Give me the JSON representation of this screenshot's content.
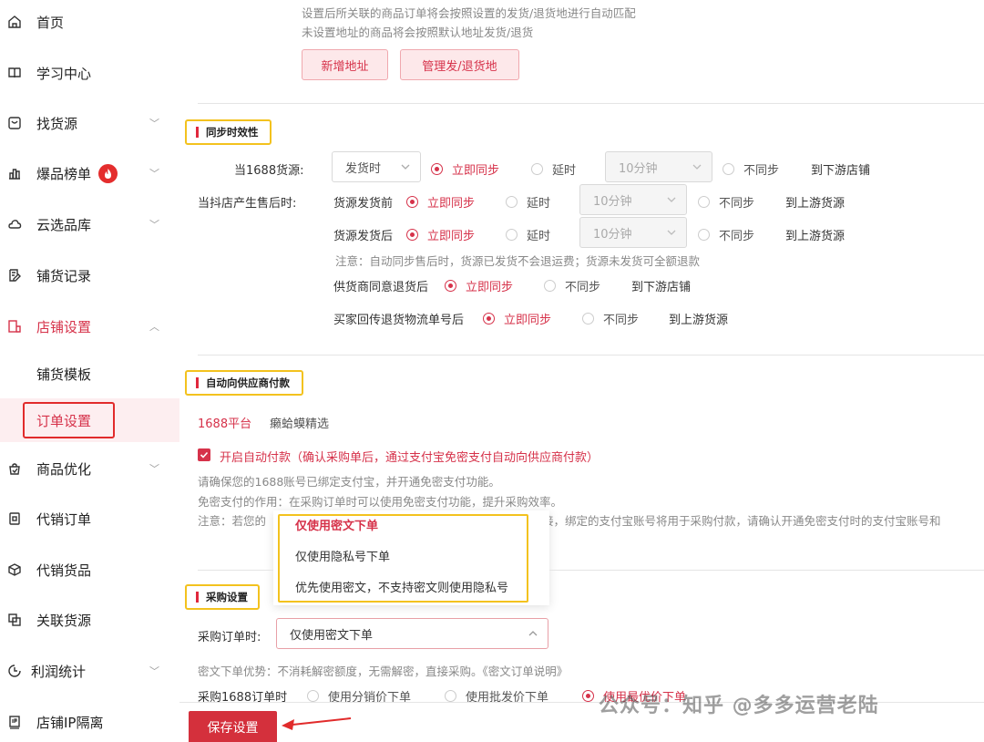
{
  "sidebar": {
    "items": [
      {
        "label": "首页",
        "icon": "home-icon"
      },
      {
        "label": "学习中心",
        "icon": "book-icon"
      },
      {
        "label": "找货源",
        "icon": "search-box-icon"
      },
      {
        "label": "爆品榜单",
        "icon": "chart-icon"
      },
      {
        "label": "云选品库",
        "icon": "cloud-icon"
      },
      {
        "label": "铺货记录",
        "icon": "record-icon"
      },
      {
        "label": "店铺设置",
        "icon": "store-settings-icon"
      },
      {
        "label": "商品优化",
        "icon": "optimize-icon"
      },
      {
        "label": "代销订单",
        "icon": "order-icon"
      },
      {
        "label": "代销货品",
        "icon": "box-icon"
      },
      {
        "label": "关联货源",
        "icon": "link-icon"
      },
      {
        "label": "利润统计",
        "icon": "clock-icon"
      },
      {
        "label": "店铺IP隔离",
        "icon": "ip-icon"
      }
    ],
    "sub_items": [
      {
        "label": "铺货模板"
      },
      {
        "label": "订单设置"
      }
    ]
  },
  "address": {
    "note1": "设置后所关联的商品订单将会按照设置的发货/退货地进行自动匹配",
    "note2": "未设置地址的商品将会按照默认地址发货/退货",
    "add_btn": "新增地址",
    "manage_btn": "管理发/退货地"
  },
  "sync": {
    "tag": "同步时效性",
    "row1_label": "当1688货源:",
    "row1_select": "发货时",
    "row2_label": "当抖店产生售后时:",
    "before_label": "货源发货前",
    "after_label": "货源发货后",
    "immediate": "立即同步",
    "delay": "延时",
    "delay_value": "10分钟",
    "no_sync": "不同步",
    "to_downstream_shop": "到下游店铺",
    "to_upstream": "到上游货源",
    "note": "注意：自动同步售后时，货源已发货不会退运费；货源未发货可全额退款",
    "supplier_label": "供货商同意退货后",
    "buyer_label": "买家回传退货物流单号后"
  },
  "autopay": {
    "tag": "自动向供应商付款",
    "tab_1688": "1688平台",
    "tab_other": "癞蛤蟆精选",
    "checkbox_label": "开启自动付款（确认采购单后，通过支付宝免密支付自动向供应商付款）",
    "line1": "请确保您的1688账号已绑定支付宝，并开通免密支付功能。",
    "line2": "免密支付的作用：在采购订单时可以使用免密支付功能，提升采购效率。",
    "line3_start": "注意：若您的",
    "line3_end": "接，绑定的支付宝账号将用于采购付款，请确认开通免密支付时的支付宝账号和"
  },
  "dropdown": {
    "options": [
      "仅使用密文下单",
      "仅使用隐私号下单",
      "优先使用密文，不支持密文则使用隐私号"
    ]
  },
  "purchase": {
    "tag": "采购设置",
    "order_label": "采购订单时:",
    "order_value": "仅使用密文下单",
    "advantage": "密文下单优势：不消耗解密额度，无需解密，直接采购。《密文订单说明》",
    "price_label": "采购1688订单时",
    "price_opt1": "使用分销价下单",
    "price_opt2": "使用批发价下单",
    "price_opt3": "使用最优价下单"
  },
  "footer": {
    "save_btn": "保存设置",
    "watermark": "公众号：知乎 @多多运营老陆"
  },
  "colors": {
    "accent": "#d6324a",
    "highlight_yellow": "#f3c21e",
    "highlight_red": "#e12b2b"
  }
}
